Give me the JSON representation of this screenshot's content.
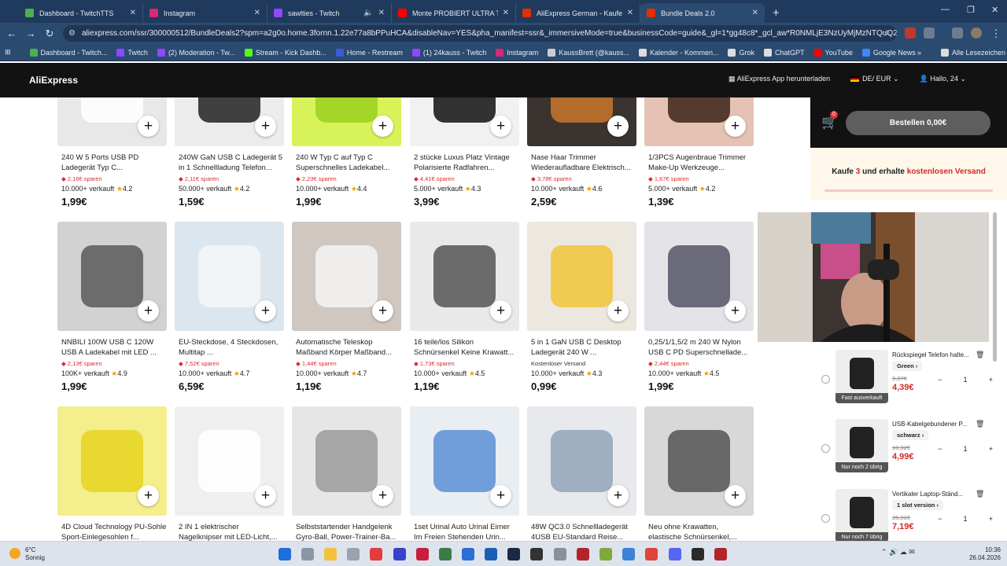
{
  "browser": {
    "tabs": [
      {
        "title": "Dashboard - TwitchTTS",
        "color": "#4caf50"
      },
      {
        "title": "Instagram",
        "color": "#d6297a"
      },
      {
        "title": "sawlties - Twitch",
        "color": "#9146ff"
      },
      {
        "title": "Monte PROBIERT ULTRA Tot Sa",
        "color": "#ff0000"
      },
      {
        "title": "AliExpress German - Kaufen Sie",
        "color": "#e62e04"
      },
      {
        "title": "Bundle Deals 2.0",
        "color": "#e62e04"
      }
    ],
    "url": "aliexpress.com/ssr/300000512/BundleDeals2?spm=a2g0o.home.3fornn.1.22e77a8bPPuHCA&disableNav=YES&pha_manifest=ssr&_immersiveMode=true&businessCode=guide&_gl=1*gg48c8*_gcl_aw*R0NMLjE3NzUyMjMzNTQuQ2owS0NRan...",
    "bookmarks": [
      {
        "label": "Dashboard - Twitch...",
        "color": "#4caf50"
      },
      {
        "label": "Twitch",
        "color": "#9146ff"
      },
      {
        "label": "(2) Moderation - Tw...",
        "color": "#9146ff"
      },
      {
        "label": "Stream - Kick Dashb...",
        "color": "#53fc18"
      },
      {
        "label": "Home - Restream",
        "color": "#3a5bd9"
      },
      {
        "label": "(1) 24kauss - Twitch",
        "color": "#9146ff"
      },
      {
        "label": "Instagram",
        "color": "#d6297a"
      },
      {
        "label": "KaussBrett (@kauss...",
        "color": "#cccccc"
      },
      {
        "label": "Kalender - Kommen...",
        "color": "#dddddd"
      },
      {
        "label": "Grok",
        "color": "#dddddd"
      },
      {
        "label": "ChatGPT",
        "color": "#dddddd"
      },
      {
        "label": "YouTube",
        "color": "#ff0000"
      },
      {
        "label": "Google News",
        "color": "#4285f4"
      }
    ],
    "bookmarks_more": "»",
    "all_bookmarks": "Alle Lesezeichen"
  },
  "header": {
    "logo": "AliExpress",
    "app_download": "AliExpress App herunterladen",
    "locale": "DE/ EUR",
    "greeting": "Hallo, 24"
  },
  "products": [
    {
      "title": "240 W 5 Ports USB PD Ladegerät Typ C...",
      "saving": "2,16€ sparen",
      "sold": "10.000+ verkauft",
      "rating": "4.2",
      "price": "1,99€",
      "bg": "#e8e8e8",
      "fg": "#ffffff"
    },
    {
      "title": "240W GaN USB C Ladegerät 5 in 1 Schnellladung Telefon...",
      "saving": "2,11€ sparen",
      "sold": "50.000+ verkauft",
      "rating": "4.2",
      "price": "1,59€",
      "bg": "#ececec",
      "fg": "#222222"
    },
    {
      "title": "240 W Typ C auf Typ C Superschnelles Ladekabel...",
      "saving": "2,23€ sparen",
      "sold": "10.000+ verkauft",
      "rating": "4.4",
      "price": "1,99€",
      "bg": "#d8f25a",
      "fg": "#9bd11e"
    },
    {
      "title": "2 stücke Luxus Platz Vintage Polarisierte Radfahren...",
      "saving": "4,41€ sparen",
      "sold": "5.000+ verkauft",
      "rating": "4.3",
      "price": "3,99€",
      "bg": "#f1f1f1",
      "fg": "#111111"
    },
    {
      "title": "Nase Haar Trimmer Wiederaufladbare Elektrisch...",
      "saving": "3,78€ sparen",
      "sold": "10.000+ verkauft",
      "rating": "4.6",
      "price": "2,59€",
      "bg": "#3a3330",
      "fg": "#c9772a"
    },
    {
      "title": "1/3PCS Augenbraue Trimmer Make-Up Werkzeuge...",
      "saving": "1,67€ sparen",
      "sold": "5.000+ verkauft",
      "rating": "4.2",
      "price": "1,39€",
      "bg": "#e5c2b3",
      "fg": "#3b2218"
    },
    {
      "title": "NNBILI 100W USB C 120W USB A Ladekabel mit LED ...",
      "saving": "2,13€ sparen",
      "sold": "100K+ verkauft",
      "rating": "4.9",
      "price": "1,99€",
      "bg": "#d2d2d2",
      "fg": "#5a5a5a"
    },
    {
      "title": "EU-Steckdose, 4 Steckdosen, Multitap ...",
      "saving": "7,52€ sparen",
      "sold": "10.000+ verkauft",
      "rating": "4.7",
      "price": "6,59€",
      "bg": "#dbe6ef",
      "fg": "#f6f6f6"
    },
    {
      "title": "Automatische Teleskop Maßband Körper Maßband...",
      "saving": "1,44€ sparen",
      "sold": "10.000+ verkauft",
      "rating": "4.7",
      "price": "1,19€",
      "bg": "#cfc7c0",
      "fg": "#f4f4f4"
    },
    {
      "title": "16 teile/los Silikon Schnürsenkel Keine Krawatt...",
      "saving": "1,73€ sparen",
      "sold": "10.000+ verkauft",
      "rating": "4.5",
      "price": "1,19€",
      "bg": "#e9e9e9",
      "fg": "#555555"
    },
    {
      "title": "5 in 1 GaN USB C Desktop Ladegerät 240 W ...",
      "saving": "Kostenloser Versand",
      "sold": "10.000+ verkauft",
      "rating": "4.3",
      "price": "0,99€",
      "bg": "#ece8df",
      "fg": "#f2c43a"
    },
    {
      "title": "0,25/1/1,5/2 m 240 W Nylon USB C PD Superschnellade...",
      "saving": "2,44€ sparen",
      "sold": "10.000+ verkauft",
      "rating": "4.5",
      "price": "1,99€",
      "bg": "#e4e4e8",
      "fg": "#555566"
    },
    {
      "title": "4D Cloud Technology PU-Sohle Sport-Einlegesohlen f...",
      "bg": "#f4ee8c",
      "fg": "#e6d31e"
    },
    {
      "title": "2 IN 1 elektrischer Nagelknipser mit LED-Licht,...",
      "bg": "#efefef",
      "fg": "#ffffff"
    },
    {
      "title": "Selbststartender Handgelenk Gyro-Ball, Power-Trainer-Ba...",
      "bg": "#e6e6e6",
      "fg": "#9a9a9a"
    },
    {
      "title": "1set Urinal Auto Urinal Eimer Im Freien Stehenden Urin...",
      "bg": "#e9eef2",
      "fg": "#5b8fd6"
    },
    {
      "title": "48W QC3.0 Schnellladegerät 4USB EU-Standard Reise...",
      "bg": "#e7e9ec",
      "fg": "#90a4bb"
    },
    {
      "title": "Neu ohne Krawatten, elastische Schnürsenkel,...",
      "bg": "#d8d8d8",
      "fg": "#555555"
    }
  ],
  "sidebar": {
    "cart_count": "0",
    "order_button": "Bestellen 0,00€",
    "promo_pre": "Kaufe ",
    "promo_num": "3",
    "promo_mid": " und erhalte ",
    "promo_red": "kostenlosen Versand",
    "items": [
      {
        "title": "Rückspiegel Telefon halte...",
        "variant": "Green",
        "old": "9,37€",
        "price": "4,39€",
        "qty": "1",
        "tag": "Fast ausverkauft"
      },
      {
        "title": "USB-Kabelgebundener P...",
        "variant": "schwarz",
        "old": "10,32€",
        "price": "4,99€",
        "qty": "1",
        "tag": "Nur noch 2 übrig"
      },
      {
        "title": "Vertikaler Laptop-Ständ...",
        "variant": "1 slot version",
        "old": "25,31€",
        "price": "7,19€",
        "qty": "1",
        "tag": "Nur noch 7 übrig"
      }
    ]
  },
  "taskbar": {
    "temp": "6°C",
    "weather": "Sonnig",
    "time": "10:36",
    "date": "26.04.2026"
  },
  "colors": {
    "brand": "#e62e04",
    "price_red": "#d42a2a",
    "star": "#f0a000"
  }
}
